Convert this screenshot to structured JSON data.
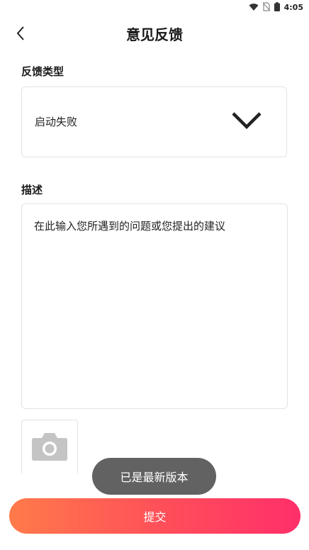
{
  "status_bar": {
    "time": "4:05",
    "icons": [
      "wifi-icon",
      "no-sim-icon",
      "battery-icon"
    ]
  },
  "header": {
    "title": "意见反馈",
    "back_icon": "back-arrow-icon"
  },
  "feedback_type": {
    "label": "反馈类型",
    "selected": "启动失败",
    "dropdown_icon": "chevron-down-icon"
  },
  "description": {
    "label": "描述",
    "placeholder": "在此输入您所遇到的问题或您提出的建议"
  },
  "photo": {
    "icon": "camera-icon"
  },
  "toast": {
    "message": "已是最新版本"
  },
  "submit": {
    "label": "提交"
  },
  "colors": {
    "accent_start": "#ff7a4a",
    "accent_end": "#ff2f6a",
    "border": "#e3e3e3",
    "toast_bg": "#555555"
  }
}
